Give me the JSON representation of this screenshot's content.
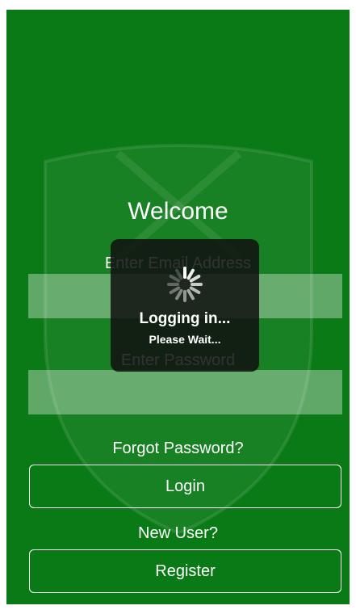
{
  "colors": {
    "background": "#0a7a16",
    "text": "#ffffff",
    "hud": "#101010"
  },
  "welcome": {
    "title": "Welcome"
  },
  "form": {
    "email_label": "Enter Email Address",
    "email_value": "",
    "email_placeholder": "",
    "password_label": "Enter Password",
    "password_value": "",
    "password_placeholder": ""
  },
  "links": {
    "forgot_password": "Forgot Password?",
    "new_user": "New User?"
  },
  "buttons": {
    "login": "Login",
    "register": "Register"
  },
  "loading": {
    "title": "Logging in...",
    "subtitle": "Please Wait...",
    "icon": "spinner-icon"
  },
  "background": {
    "icon": "crest-icon"
  }
}
